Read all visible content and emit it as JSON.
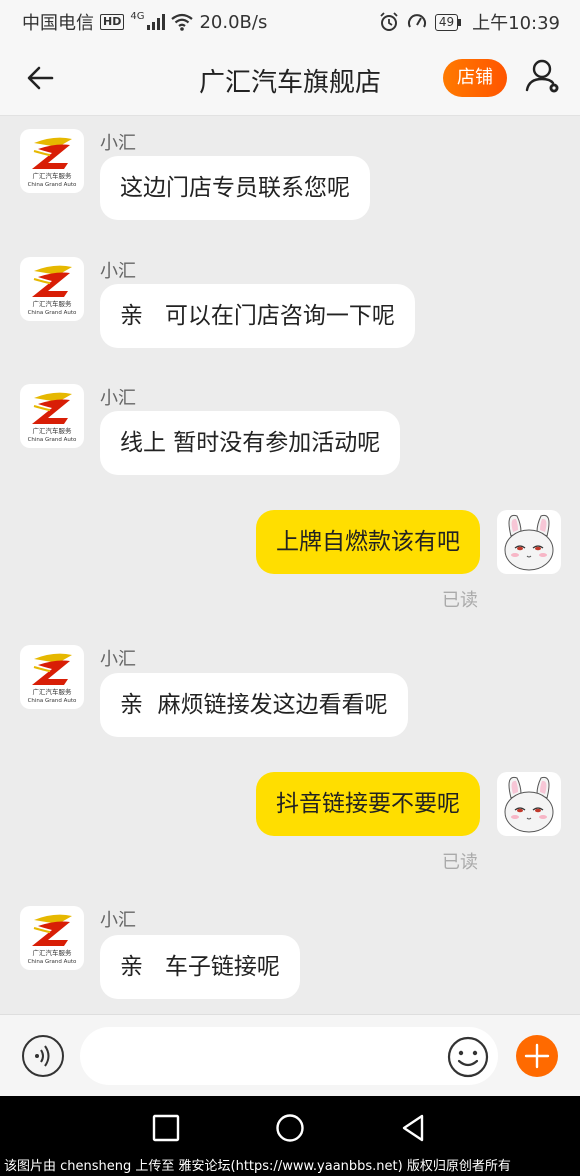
{
  "status_bar": {
    "carrier": "中国电信",
    "hd": "HD",
    "network": "4G",
    "speed": "20.0B/s",
    "battery": "49",
    "time": "上午10:39"
  },
  "header": {
    "title": "广汇汽车旗舰店",
    "store_label": "店铺"
  },
  "messages": [
    {
      "side": "in",
      "sender": "小汇",
      "text": "这边门店专员联系您呢"
    },
    {
      "side": "in",
      "sender": "小汇",
      "text": "亲   可以在门店咨询一下呢"
    },
    {
      "side": "in",
      "sender": "小汇",
      "text": "线上 暂时没有参加活动呢"
    },
    {
      "side": "out",
      "text": "上牌自燃款该有吧",
      "status": "已读"
    },
    {
      "side": "in",
      "sender": "小汇",
      "text": "亲  麻烦链接发这边看看呢"
    },
    {
      "side": "out",
      "text": "抖音链接要不要呢",
      "status": "已读"
    },
    {
      "side": "in",
      "sender": "小汇",
      "text": "亲   车子链接呢"
    }
  ],
  "shop_logo": {
    "line1": "广汇汽车服务",
    "line2": "China Grand Auto"
  },
  "input": {
    "placeholder": "",
    "value": ""
  },
  "watermark": "该图片由 chensheng 上传至 雅安论坛(https://www.yaanbbs.net) 版权归原创者所有",
  "colors": {
    "accent": "#ff6a00",
    "outgoing_bubble": "#ffde00",
    "incoming_bubble": "#ffffff",
    "background": "#ececec"
  }
}
